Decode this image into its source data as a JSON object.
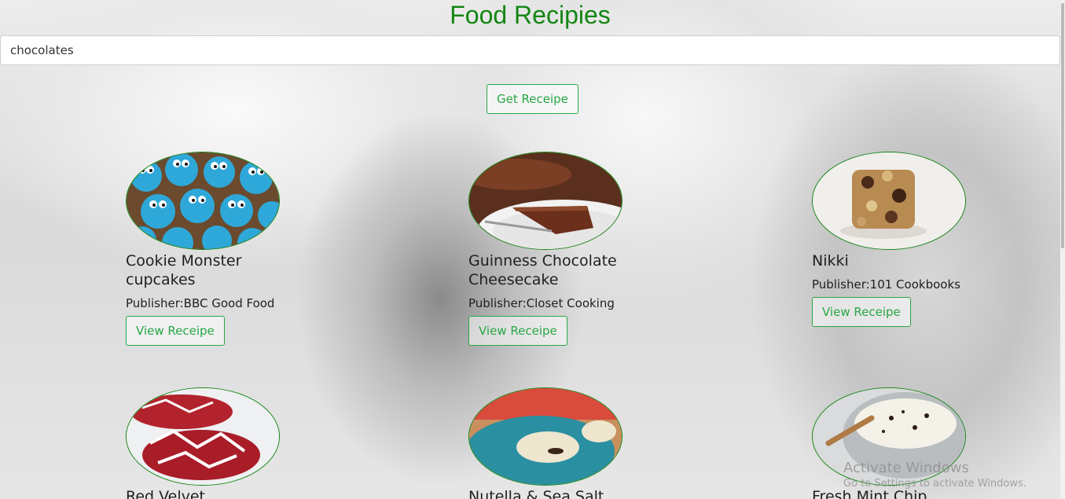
{
  "header": {
    "title": "Food Recipies"
  },
  "search": {
    "value": "chocolates"
  },
  "actions": {
    "get_label": "Get Receipe"
  },
  "recipes": [
    {
      "title": "Cookie Monster cupcakes",
      "publisher": "Publisher:BBC Good Food",
      "button": "View Receipe"
    },
    {
      "title": "Guinness Chocolate Cheesecake",
      "publisher": "Publisher:Closet Cooking",
      "button": "View Receipe"
    },
    {
      "title": "Nikki",
      "publisher": "Publisher:101 Cookbooks",
      "button": "View Receipe"
    },
    {
      "title": "Red Velvet",
      "publisher": "",
      "button": ""
    },
    {
      "title": "Nutella & Sea Salt",
      "publisher": "",
      "button": ""
    },
    {
      "title": "Fresh Mint Chip",
      "publisher": "",
      "button": ""
    }
  ],
  "watermark": {
    "line1": "Activate Windows",
    "line2": "Go to Settings to activate Windows."
  },
  "colors": {
    "accent": "#138613",
    "button": "#28a745"
  }
}
